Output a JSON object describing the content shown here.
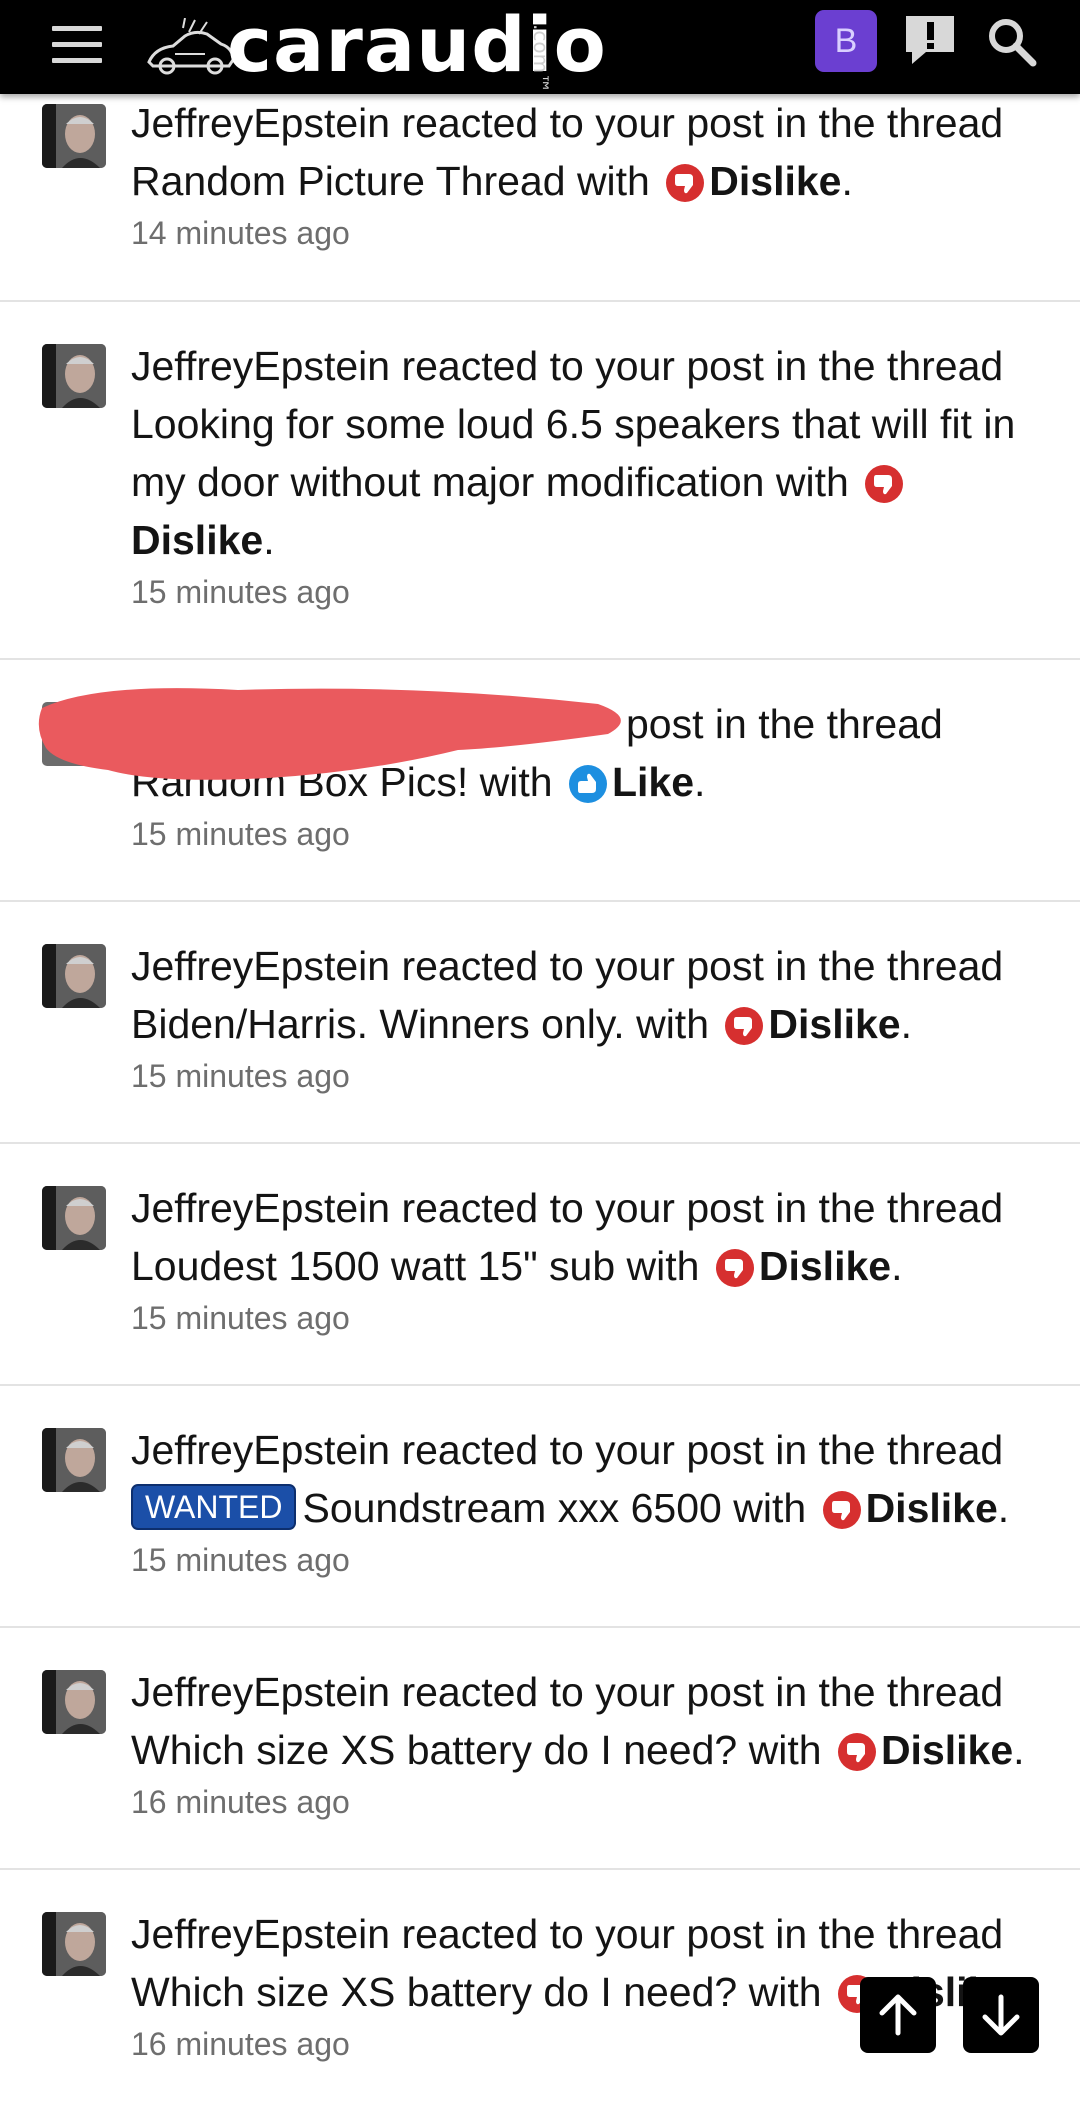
{
  "header": {
    "logo_text": "caraudio",
    "logo_suffix": ".com",
    "logo_tm": "™",
    "user_badge": "B"
  },
  "alerts": [
    {
      "user": "JeffreyEpstein",
      "action": "reacted to your post in the thread",
      "thread_prefix": "",
      "thread": "Random Picture Thread",
      "with": "with",
      "reaction": "Dislike",
      "reaction_type": "dislike",
      "time": "14 minutes ago",
      "redacted": false
    },
    {
      "user": "JeffreyEpstein",
      "action": "reacted to your post in the thread",
      "thread_prefix": "",
      "thread": "Looking for some loud 6.5 speakers that will fit in my door without major modification",
      "with": "with",
      "reaction": "Dislike",
      "reaction_type": "dislike",
      "time": "15 minutes ago",
      "redacted": false
    },
    {
      "user": "",
      "action": "post in the thread",
      "thread_prefix": "",
      "thread": "Random Box Pics!",
      "with": "with",
      "reaction": "Like",
      "reaction_type": "like",
      "time": "15 minutes ago",
      "redacted": true
    },
    {
      "user": "JeffreyEpstein",
      "action": "reacted to your post in the thread",
      "thread_prefix": "",
      "thread": "Biden/Harris. Winners only.",
      "with": "with",
      "reaction": "Dislike",
      "reaction_type": "dislike",
      "time": "15 minutes ago",
      "redacted": false
    },
    {
      "user": "JeffreyEpstein",
      "action": "reacted to your post in the thread",
      "thread_prefix": "",
      "thread": "Loudest 1500 watt 15\" sub",
      "with": "with",
      "reaction": "Dislike",
      "reaction_type": "dislike",
      "time": "15 minutes ago",
      "redacted": false
    },
    {
      "user": "JeffreyEpstein",
      "action": "reacted to your post in the thread",
      "thread_prefix": "WANTED",
      "thread": "Soundstream xxx 6500",
      "with": "with",
      "reaction": "Dislike",
      "reaction_type": "dislike",
      "time": "15 minutes ago",
      "redacted": false
    },
    {
      "user": "JeffreyEpstein",
      "action": "reacted to your post in the thread",
      "thread_prefix": "",
      "thread": "Which size XS battery do I need?",
      "with": "with",
      "reaction": "Dislike",
      "reaction_type": "dislike",
      "time": "16 minutes ago",
      "redacted": false
    },
    {
      "user": "JeffreyEpstein",
      "action": "reacted to your post in the thread",
      "thread_prefix": "",
      "thread": "Which size XS battery do I need?",
      "with": "with",
      "reaction": "Dislike",
      "reaction_type": "dislike",
      "time": "16 minutes ago",
      "redacted": false
    }
  ],
  "colors": {
    "header_bg": "#000000",
    "user_badge_bg": "#6b3fd1",
    "dislike_red": "#d62f2f",
    "like_blue": "#1d8fe0",
    "prefix_blue": "#1b4fa8",
    "redaction": "#ea5a5e"
  },
  "icons": {
    "menu": "hamburger-menu-icon",
    "alerts": "alert-bubble-icon",
    "search": "magnifier-icon",
    "scroll_up": "arrow-up-icon",
    "scroll_down": "arrow-down-icon"
  }
}
